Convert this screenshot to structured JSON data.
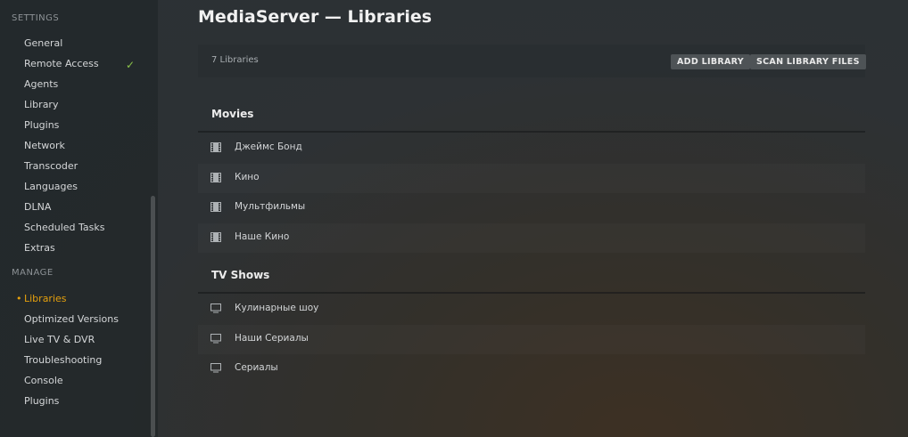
{
  "sidebar": {
    "settings_heading": "SETTINGS",
    "settings_items": [
      {
        "label": "General"
      },
      {
        "label": "Remote Access",
        "checked": true
      },
      {
        "label": "Agents"
      },
      {
        "label": "Library"
      },
      {
        "label": "Plugins"
      },
      {
        "label": "Network"
      },
      {
        "label": "Transcoder"
      },
      {
        "label": "Languages"
      },
      {
        "label": "DLNA"
      },
      {
        "label": "Scheduled Tasks"
      },
      {
        "label": "Extras"
      }
    ],
    "manage_heading": "MANAGE",
    "manage_items": [
      {
        "label": "Libraries",
        "active": true
      },
      {
        "label": "Optimized Versions"
      },
      {
        "label": "Live TV & DVR"
      },
      {
        "label": "Troubleshooting"
      },
      {
        "label": "Console"
      },
      {
        "label": "Plugins"
      }
    ]
  },
  "main": {
    "title": "MediaServer — Libraries",
    "library_count": "7 Libraries",
    "add_library_label": "ADD LIBRARY",
    "scan_library_label": "SCAN LIBRARY FILES",
    "groups": [
      {
        "title": "Movies",
        "icon": "film-icon",
        "items": [
          "Джеймс Бонд",
          "Кино",
          "Мультфильмы",
          "Наше Кино"
        ]
      },
      {
        "title": "TV Shows",
        "icon": "monitor-icon",
        "items": [
          "Кулинарные шоу",
          "Наши Сериалы",
          "Сериалы"
        ]
      }
    ]
  },
  "colors": {
    "accent": "#e5a00d",
    "check": "#8bc34a"
  }
}
